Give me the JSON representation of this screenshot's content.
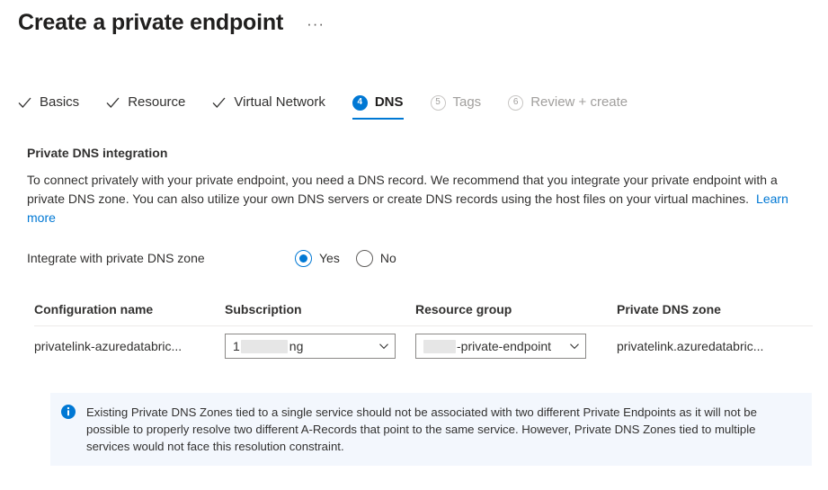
{
  "header": {
    "title": "Create a private endpoint",
    "more_actions": "···"
  },
  "wizard": {
    "tabs": [
      {
        "label": "Basics",
        "state": "done",
        "icon": "check-icon"
      },
      {
        "label": "Resource",
        "state": "done",
        "icon": "check-icon"
      },
      {
        "label": "Virtual Network",
        "state": "done",
        "icon": "check-icon"
      },
      {
        "label": "DNS",
        "state": "active",
        "number": "4"
      },
      {
        "label": "Tags",
        "state": "pending",
        "number": "5"
      },
      {
        "label": "Review + create",
        "state": "pending",
        "number": "6"
      }
    ],
    "active_color": "#0078d4"
  },
  "section": {
    "title": "Private DNS integration",
    "description": "To connect privately with your private endpoint, you need a DNS record. We recommend that you integrate your private endpoint with a private DNS zone. You can also utilize your own DNS servers or create DNS records using the host files on your virtual machines.",
    "learn_more": "Learn more"
  },
  "integrate": {
    "label": "Integrate with private DNS zone",
    "options": [
      {
        "label": "Yes",
        "checked": true
      },
      {
        "label": "No",
        "checked": false
      }
    ],
    "selected": "Yes"
  },
  "table": {
    "headers": {
      "configuration_name": "Configuration name",
      "subscription": "Subscription",
      "resource_group": "Resource group",
      "private_dns_zone": "Private DNS zone"
    },
    "rows": [
      {
        "configuration_name": "privatelink-azuredatabric...",
        "subscription_prefix": "1",
        "subscription_suffix": "ng",
        "resource_group_suffix": "-private-endpoint",
        "private_dns_zone": "privatelink.azuredatabric..."
      }
    ]
  },
  "info": {
    "icon": "info-icon",
    "message": "Existing Private DNS Zones tied to a single service should not be associated with two different Private Endpoints as it will not be possible to properly resolve two different A-Records that point to the same service. However, Private DNS Zones tied to multiple services would not face this resolution constraint.",
    "background": "#f3f7fd",
    "icon_color": "#0078d4"
  }
}
